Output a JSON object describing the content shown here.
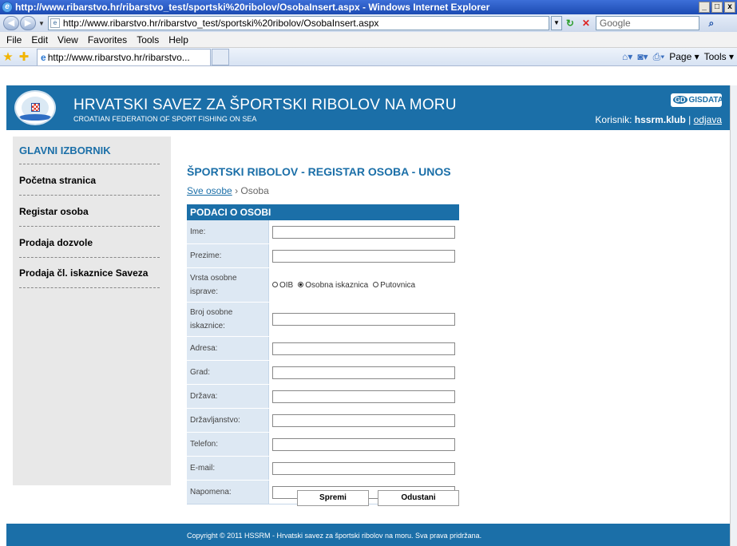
{
  "window": {
    "title": "http://www.ribarstvo.hr/ribarstvo_test/sportski%20ribolov/OsobaInsert.aspx - Windows Internet Explorer",
    "min": "_",
    "max": "□",
    "close": "x"
  },
  "address_bar": {
    "url": "http://www.ribarstvo.hr/ribarstvo_test/sportski%20ribolov/OsobaInsert.aspx",
    "search_placeholder": "Google"
  },
  "menu": [
    "File",
    "Edit",
    "View",
    "Favorites",
    "Tools",
    "Help"
  ],
  "tab": {
    "label": "http://www.ribarstvo.hr/ribarstvo..."
  },
  "command_bar": {
    "page": "Page ▾",
    "tools": "Tools ▾"
  },
  "header": {
    "title": "HRVATSKI SAVEZ ZA ŠPORTSKI RIBOLOV NA MORU",
    "subtitle": "CROATIAN FEDERATION OF SPORT FISHING ON SEA",
    "gis_logo": "GISDATA",
    "gis_badge": "GD",
    "user_label": "Korisnik:",
    "username": "hssrm.klub",
    "separator": "|",
    "logout": "odjava"
  },
  "sidebar": {
    "heading": "GLAVNI IZBORNIK",
    "items": [
      {
        "label": "Početna stranica"
      },
      {
        "label": "Registar osoba"
      },
      {
        "label": "Prodaja dozvole"
      },
      {
        "label": "Prodaja čl. iskaznice Saveza"
      }
    ]
  },
  "main": {
    "title": "ŠPORTSKI RIBOLOV - REGISTAR OSOBA - UNOS",
    "breadcrumb": {
      "link": "Sve osobe",
      "sep": "›",
      "current": "Osoba"
    }
  },
  "form": {
    "heading": "PODACI O OSOBI",
    "fields": [
      {
        "label": "Ime:",
        "value": ""
      },
      {
        "label": "Prezime:",
        "value": ""
      },
      {
        "label": "Vrsta osobne isprave:",
        "radios": [
          "OIB",
          "Osobna iskaznica",
          "Putovnica"
        ],
        "selected": "Osobna iskaznica"
      },
      {
        "label": "Broj osobne iskaznice:",
        "value": ""
      },
      {
        "label": "Adresa:",
        "value": ""
      },
      {
        "label": "Grad:",
        "value": ""
      },
      {
        "label": "Država:",
        "value": ""
      },
      {
        "label": "Državljanstvo:",
        "value": ""
      },
      {
        "label": "Telefon:",
        "value": ""
      },
      {
        "label": "E-mail:",
        "value": ""
      },
      {
        "label": "Napomena:",
        "value": ""
      }
    ],
    "save_label": "Spremi",
    "cancel_label": "Odustani"
  },
  "footer": {
    "text": "Copyright © 2011 HSSRM - Hrvatski savez za športski ribolov na moru. Sva prava pridržana."
  },
  "colors": {
    "brand_blue": "#1b6fa8",
    "sidebar_bg": "#e8e8e8",
    "label_bg": "#dde8f3"
  }
}
